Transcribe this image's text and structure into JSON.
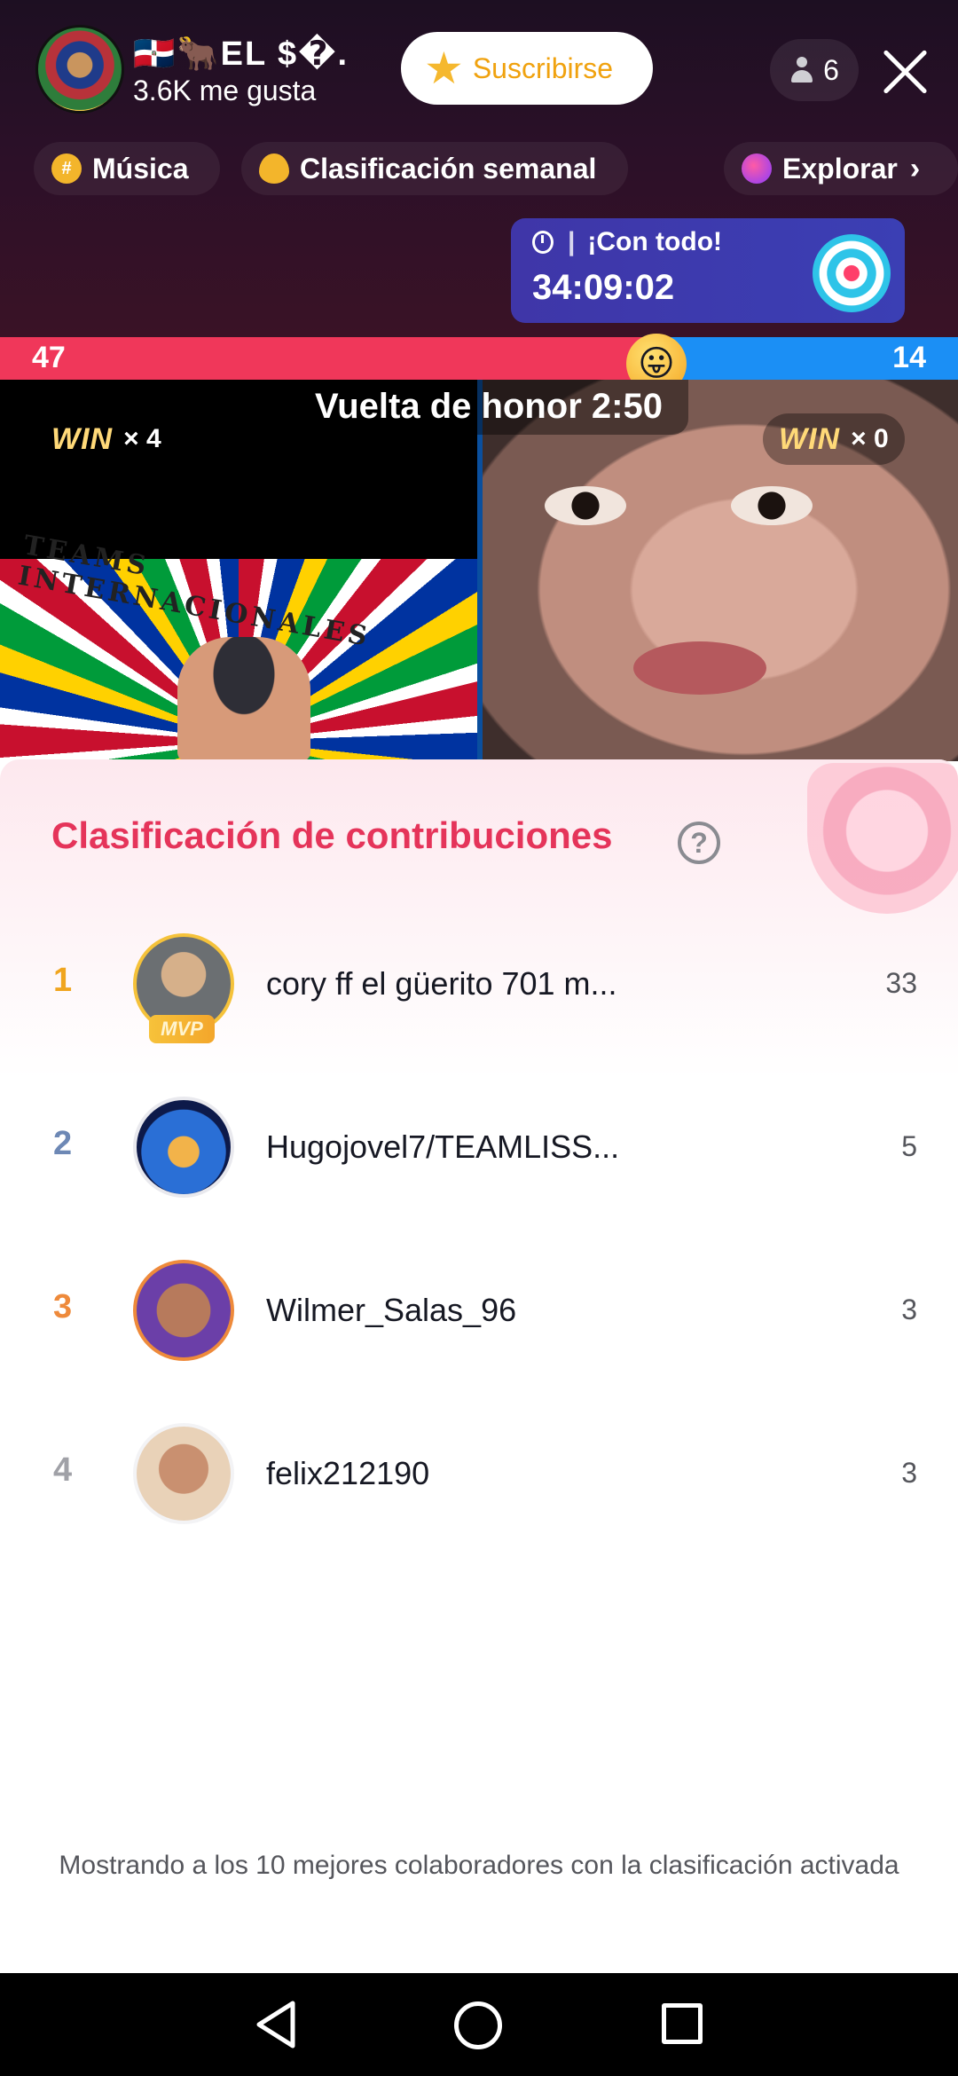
{
  "host": {
    "name": "🇩🇴🐂EL $�.",
    "likes": "3.6K me gusta",
    "subscribe_label": "Suscribirse",
    "viewer_count": "6"
  },
  "chips": {
    "music": "Música",
    "weekly": "Clasificación semanal",
    "explore": "Explorar"
  },
  "promo": {
    "label": "¡Con todo!",
    "countdown": "34:09:02"
  },
  "battle": {
    "score_left": "47",
    "score_right": "14",
    "left_share": 0.685,
    "honor_text": "Vuelta de honor 2:50",
    "win_word": "WIN",
    "left_wins": "× 4",
    "right_wins": "× 0",
    "left_video_text": "TEAMS INTERNACIONALES",
    "emoji": "😛"
  },
  "contributions": {
    "title": "Clasificación de contribuciones",
    "rows": [
      {
        "rank": "1",
        "name": "cory ff el güerito 701 m...",
        "points": "33",
        "rank_color": "#f0a51e",
        "badge": "MVP"
      },
      {
        "rank": "2",
        "name": "Hugojovel7/TEAMLISS...",
        "points": "5",
        "rank_color": "#6d88b5"
      },
      {
        "rank": "3",
        "name": "Wilmer_Salas_96",
        "points": "3",
        "rank_color": "#ee8a3b"
      },
      {
        "rank": "4",
        "name": "felix212190",
        "points": "3",
        "rank_color": "#a0a1a7"
      }
    ],
    "footer": "Mostrando a los 10 mejores colaboradores con la clasificación activada"
  },
  "colors": {
    "accent": "#e5345a",
    "battle_red": "#f0375a",
    "battle_blue": "#1b8ff5",
    "subscribe_text": "#f0a20f"
  }
}
